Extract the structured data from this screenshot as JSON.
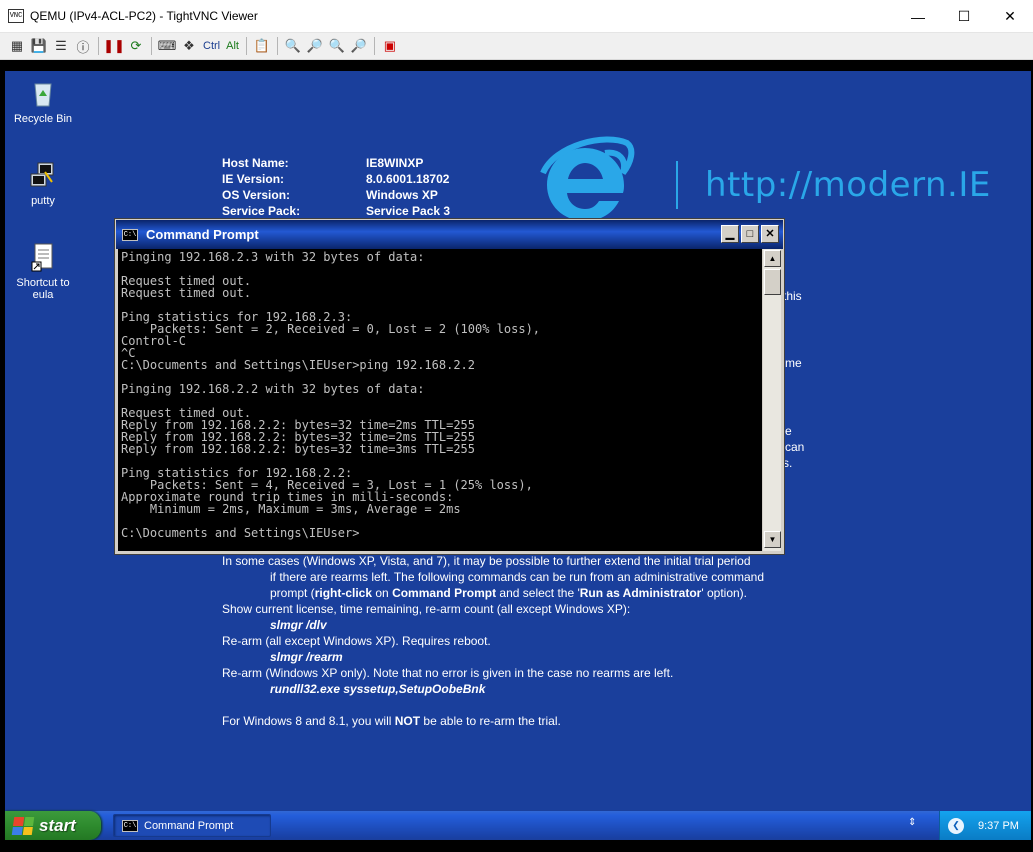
{
  "vnc": {
    "title": "QEMU (IPv4-ACL-PC2) - TightVNC Viewer",
    "app_icon_text": "VNC",
    "toolbar_text_buttons": {
      "ctrl": "Ctrl",
      "alt": "Alt"
    }
  },
  "desktop": {
    "icons": [
      {
        "label": "Recycle Bin"
      },
      {
        "label": "putty"
      },
      {
        "label": "Shortcut to eula"
      }
    ],
    "info": [
      {
        "key": "Host Name:",
        "value": "IE8WINXP"
      },
      {
        "key": "IE Version:",
        "value": "8.0.6001.18702"
      },
      {
        "key": "OS Version:",
        "value": "Windows XP"
      },
      {
        "key": "Service Pack:",
        "value": "Service Pack 3"
      }
    ],
    "ie_url": "http://modern.IE",
    "side_fragments": [
      "this",
      "me",
      "e",
      "can",
      "s."
    ],
    "body": {
      "line1": "In some cases (Windows XP, Vista, and 7), it may be possible to further extend the initial trial period",
      "line2": "if there are rearms left. The following commands can be run from an administrative command",
      "line3_a": "prompt (",
      "line3_b": "right-click",
      "line3_c": " on ",
      "line3_d": "Command Prompt",
      "line3_e": " and select the '",
      "line3_f": "Run as Administrator",
      "line3_g": "' option).",
      "line4": "Show current license, time remaining, re-arm count (all except Windows XP):",
      "cmd1": "slmgr /dlv",
      "line5": "Re-arm (all except Windows XP). Requires reboot.",
      "cmd2": "slmgr /rearm",
      "line6": "Re-arm (Windows XP only). Note that no error is given in the case no rearms are left.",
      "cmd3": "rundll32.exe syssetup,SetupOobeBnk",
      "line7_a": "For Windows 8 and 8.1, you will ",
      "line7_b": "NOT",
      "line7_c": " be able to re-arm the trial."
    }
  },
  "cmd": {
    "title": "Command Prompt",
    "icon_text": "C:\\",
    "lines": [
      "Pinging 192.168.2.3 with 32 bytes of data:",
      "",
      "Request timed out.",
      "Request timed out.",
      "",
      "Ping statistics for 192.168.2.3:",
      "    Packets: Sent = 2, Received = 0, Lost = 2 (100% loss),",
      "Control-C",
      "^C",
      "C:\\Documents and Settings\\IEUser>ping 192.168.2.2",
      "",
      "Pinging 192.168.2.2 with 32 bytes of data:",
      "",
      "Request timed out.",
      "Reply from 192.168.2.2: bytes=32 time=2ms TTL=255",
      "Reply from 192.168.2.2: bytes=32 time=2ms TTL=255",
      "Reply from 192.168.2.2: bytes=32 time=3ms TTL=255",
      "",
      "Ping statistics for 192.168.2.2:",
      "    Packets: Sent = 4, Received = 3, Lost = 1 (25% loss),",
      "Approximate round trip times in milli-seconds:",
      "    Minimum = 2ms, Maximum = 3ms, Average = 2ms",
      "",
      "C:\\Documents and Settings\\IEUser>"
    ]
  },
  "taskbar": {
    "start_label": "start",
    "task_label": "Command Prompt",
    "clock": "9:37 PM"
  },
  "colors": {
    "desktop_bg": "#1a3f9c",
    "ie_blue": "#2aa7e8",
    "xp_title_blue": "#0a246a",
    "start_green": "#2e8b2e"
  }
}
